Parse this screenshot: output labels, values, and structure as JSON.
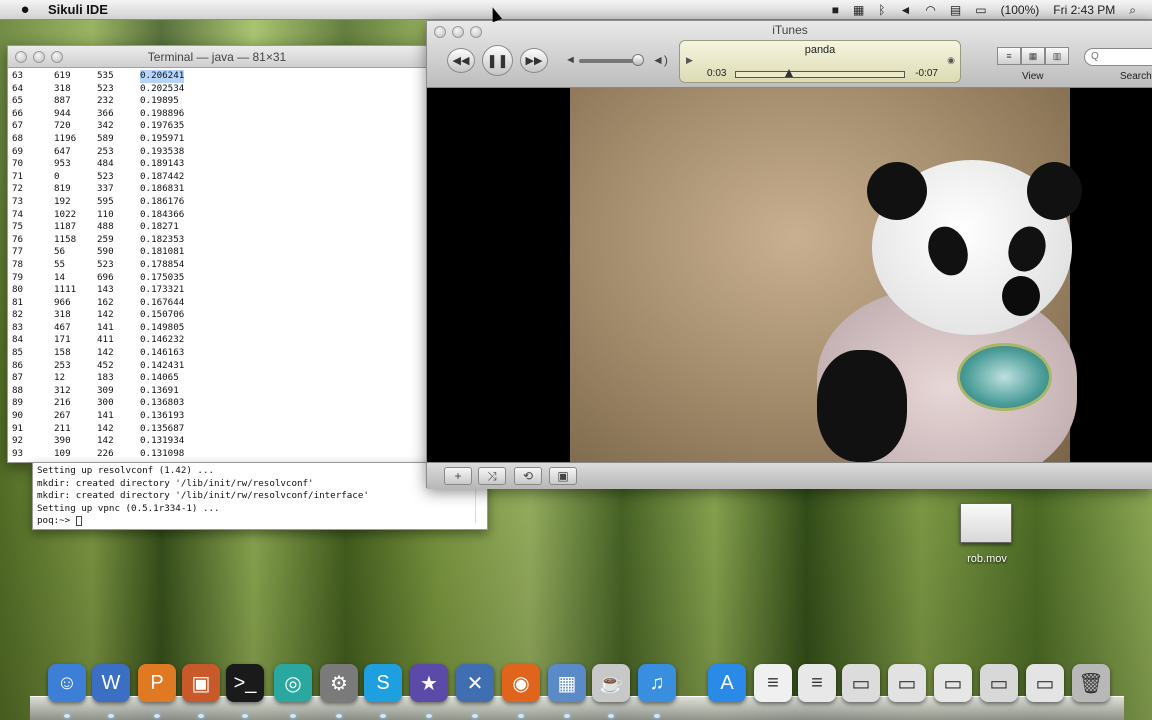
{
  "menubar": {
    "app_name": "Sikuli IDE",
    "battery": "(100%)",
    "clock": "Fri 2:43 PM",
    "icons": [
      "video-icon",
      "memory-icon",
      "bluetooth-icon",
      "volume-icon",
      "wifi-icon",
      "flag-icon",
      "battery-icon",
      "spotlight-icon"
    ]
  },
  "terminal": {
    "title": "Terminal — java — 81×31",
    "rows": [
      [
        "63",
        "619",
        "535",
        "0.206241"
      ],
      [
        "64",
        "318",
        "523",
        "0.202534"
      ],
      [
        "65",
        "887",
        "232",
        "0.19895"
      ],
      [
        "66",
        "944",
        "366",
        "0.198896"
      ],
      [
        "67",
        "720",
        "342",
        "0.197635"
      ],
      [
        "68",
        "1196",
        "589",
        "0.195971"
      ],
      [
        "69",
        "647",
        "253",
        "0.193538"
      ],
      [
        "70",
        "953",
        "484",
        "0.189143"
      ],
      [
        "71",
        "0",
        "523",
        "0.187442"
      ],
      [
        "72",
        "819",
        "337",
        "0.186831"
      ],
      [
        "73",
        "192",
        "595",
        "0.186176"
      ],
      [
        "74",
        "1022",
        "110",
        "0.184366"
      ],
      [
        "75",
        "1187",
        "488",
        "0.18271"
      ],
      [
        "76",
        "1158",
        "259",
        "0.182353"
      ],
      [
        "77",
        "56",
        "590",
        "0.181081"
      ],
      [
        "78",
        "55",
        "523",
        "0.178854"
      ],
      [
        "79",
        "14",
        "696",
        "0.175035"
      ],
      [
        "80",
        "1111",
        "143",
        "0.173321"
      ],
      [
        "81",
        "966",
        "162",
        "0.167644"
      ],
      [
        "82",
        "318",
        "142",
        "0.150706"
      ],
      [
        "83",
        "467",
        "141",
        "0.149805"
      ],
      [
        "84",
        "171",
        "411",
        "0.146232"
      ],
      [
        "85",
        "158",
        "142",
        "0.146163"
      ],
      [
        "86",
        "253",
        "452",
        "0.142431"
      ],
      [
        "87",
        "12",
        "183",
        "0.14065"
      ],
      [
        "88",
        "312",
        "309",
        "0.13691"
      ],
      [
        "89",
        "216",
        "300",
        "0.136803"
      ],
      [
        "90",
        "267",
        "141",
        "0.136193"
      ],
      [
        "91",
        "211",
        "142",
        "0.135687"
      ],
      [
        "92",
        "390",
        "142",
        "0.131934"
      ],
      [
        "93",
        "109",
        "226",
        "0.131098"
      ]
    ]
  },
  "terminal2": {
    "lines": [
      "Setting up resolvconf (1.42) ...",
      "mkdir: created directory '/lib/init/rw/resolvconf'",
      "mkdir: created directory '/lib/init/rw/resolvconf/interface'",
      "Setting up vpnc (0.5.1r334-1) ..."
    ],
    "prompt": "poq:~>"
  },
  "itunes": {
    "title": "iTunes",
    "now_playing": "panda",
    "elapsed": "0:03",
    "remaining": "-0:07",
    "progress_fraction": 0.32,
    "volume_fraction": 0.92,
    "view_label": "View",
    "search_label": "Search",
    "search_placeholder": "Q"
  },
  "desktop": {
    "file_name": "rob.mov"
  },
  "dock": {
    "items": [
      {
        "name": "finder",
        "color": "#3d7fd6",
        "glyph": "☺"
      },
      {
        "name": "word",
        "color": "#3a6fc4",
        "glyph": "W"
      },
      {
        "name": "powerpoint",
        "color": "#e07a22",
        "glyph": "P"
      },
      {
        "name": "preview",
        "color": "#c85a2a",
        "glyph": "▣"
      },
      {
        "name": "terminal",
        "color": "#1a1a1a",
        "glyph": ">_"
      },
      {
        "name": "sikuli",
        "color": "#2aa8a0",
        "glyph": "◎"
      },
      {
        "name": "system-preferences",
        "color": "#7a7a7a",
        "glyph": "⚙"
      },
      {
        "name": "skype",
        "color": "#1ea0e0",
        "glyph": "S"
      },
      {
        "name": "imovie",
        "color": "#5b4aa8",
        "glyph": "★"
      },
      {
        "name": "xcode",
        "color": "#3f6fb0",
        "glyph": "✕"
      },
      {
        "name": "firefox",
        "color": "#e0641c",
        "glyph": "◉"
      },
      {
        "name": "iphoto",
        "color": "#5a8ac8",
        "glyph": "▦"
      },
      {
        "name": "java",
        "color": "#c8c8c8",
        "glyph": "☕"
      },
      {
        "name": "itunes",
        "color": "#3a8ee0",
        "glyph": "♫"
      },
      {
        "name": "app-store",
        "color": "#2a8ae8",
        "glyph": "A"
      },
      {
        "name": "document-1",
        "color": "#f0f0f0",
        "glyph": "≡"
      },
      {
        "name": "document-2",
        "color": "#e8e8e8",
        "glyph": "≡"
      },
      {
        "name": "window-1",
        "color": "#dcdcdc",
        "glyph": "▭"
      },
      {
        "name": "window-2",
        "color": "#e2e2e2",
        "glyph": "▭"
      },
      {
        "name": "window-3",
        "color": "#e6e6e6",
        "glyph": "▭"
      },
      {
        "name": "window-4",
        "color": "#d8d8d8",
        "glyph": "▭"
      },
      {
        "name": "window-5",
        "color": "#e4e4e4",
        "glyph": "▭"
      },
      {
        "name": "trash",
        "color": "#b8b8b8",
        "glyph": "🗑"
      }
    ]
  }
}
